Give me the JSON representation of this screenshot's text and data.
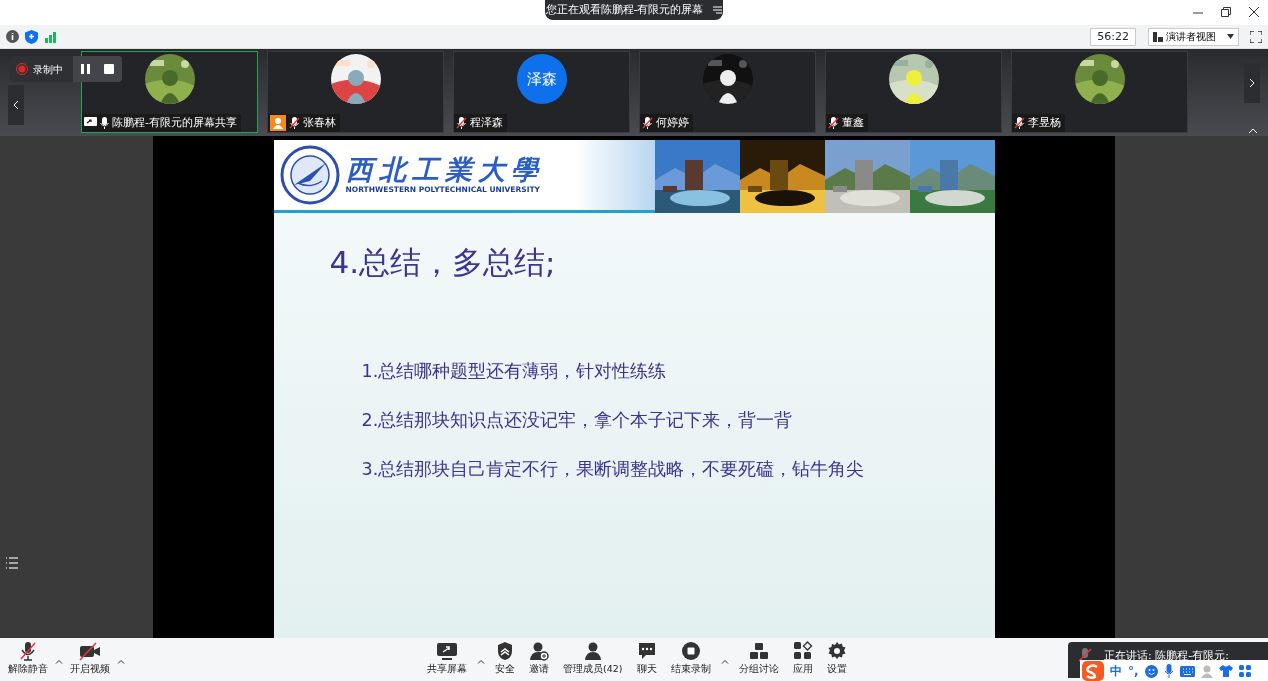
{
  "window": {
    "share_banner": "您正在观看陈鹏程-有限元的屏幕"
  },
  "info_bar": {
    "timer": "56:22",
    "view_button": "演讲者视图"
  },
  "recording": {
    "label": "录制中"
  },
  "participants": [
    {
      "name": "陈鹏程-有限元的屏幕共享",
      "kind": "sharer",
      "muted": false,
      "active": true
    },
    {
      "name": "张春林",
      "kind": "host",
      "muted": true,
      "active": false
    },
    {
      "name": "程泽森",
      "kind": "guest",
      "initials": "泽森",
      "muted": true,
      "active": false
    },
    {
      "name": "何婷婷",
      "kind": "guest",
      "muted": true,
      "active": false
    },
    {
      "name": "董鑫",
      "kind": "guest",
      "muted": true,
      "active": false
    },
    {
      "name": "李昱杨",
      "kind": "guest",
      "muted": true,
      "active": false
    }
  ],
  "slide": {
    "logo_text": "西北工業大學",
    "logo_subtitle": "NORTHWESTERN POLYTECHNICAL UNIVERSITY",
    "title": "4.总结，多总结;",
    "points": [
      "1.总结哪种题型还有薄弱，针对性练练",
      "2.总结那块知识点还没记牢，拿个本子记下来，背一背",
      "3.总结那块自己肯定不行，果断调整战略，不要死磕，钻牛角尖"
    ]
  },
  "toolbar_left": [
    {
      "label": "解除静音",
      "kind": "audio",
      "caret": true
    },
    {
      "label": "开启视频",
      "kind": "video",
      "caret": true
    }
  ],
  "toolbar_center": [
    {
      "label": "共享屏幕",
      "kind": "share",
      "caret": true
    },
    {
      "label": "安全",
      "kind": "security",
      "caret": false
    },
    {
      "label": "邀请",
      "kind": "invite",
      "caret": false
    },
    {
      "label": "管理成员(42)",
      "kind": "members",
      "caret": false
    },
    {
      "label": "聊天",
      "kind": "chat",
      "caret": false
    },
    {
      "label": "结束录制",
      "kind": "record",
      "caret": true
    },
    {
      "label": "分组讨论",
      "kind": "rooms",
      "caret": false
    },
    {
      "label": "应用",
      "kind": "apps",
      "caret": false
    },
    {
      "label": "设置",
      "kind": "settings",
      "caret": false
    }
  ],
  "speaking": {
    "text": "正在讲话: 陈鹏程-有限元:"
  },
  "ime": {
    "mode": "中",
    "punct": "°,"
  }
}
